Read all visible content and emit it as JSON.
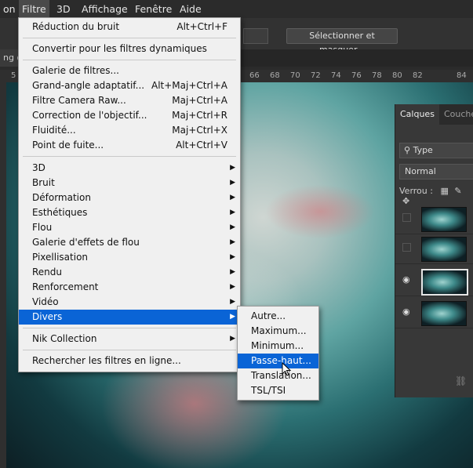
{
  "menubar": {
    "items": [
      "on",
      "Filtre",
      "3D",
      "Affichage",
      "Fenêtre",
      "Aide"
    ]
  },
  "options": {
    "select_mask_button": "Sélectionner et masquer..."
  },
  "doc_tab": "ng @",
  "ruler": {
    "ticks": [
      "5",
      "66",
      "68",
      "70",
      "72",
      "74",
      "76",
      "78",
      "80",
      "82",
      "84"
    ]
  },
  "layers_panel": {
    "tabs": [
      "Calques",
      "Couches"
    ],
    "kind_filter": "Type",
    "blend_mode": "Normal",
    "lock_label": "Verrou :"
  },
  "filter_menu": {
    "items": [
      {
        "label": "Réduction du bruit",
        "shortcut": "Alt+Ctrl+F"
      },
      {
        "label": "Convertir pour les filtres dynamiques",
        "shortcut": ""
      },
      {
        "label": "Galerie de filtres...",
        "shortcut": ""
      },
      {
        "label": "Grand-angle adaptatif...",
        "shortcut": "Alt+Maj+Ctrl+A"
      },
      {
        "label": "Filtre Camera Raw...",
        "shortcut": "Maj+Ctrl+A"
      },
      {
        "label": "Correction de l'objectif...",
        "shortcut": "Maj+Ctrl+R"
      },
      {
        "label": "Fluidité...",
        "shortcut": "Maj+Ctrl+X"
      },
      {
        "label": "Point de fuite...",
        "shortcut": "Alt+Ctrl+V"
      },
      {
        "label": "3D",
        "shortcut": ""
      },
      {
        "label": "Bruit",
        "shortcut": ""
      },
      {
        "label": "Déformation",
        "shortcut": ""
      },
      {
        "label": "Esthétiques",
        "shortcut": ""
      },
      {
        "label": "Flou",
        "shortcut": ""
      },
      {
        "label": "Galerie d'effets de flou",
        "shortcut": ""
      },
      {
        "label": "Pixellisation",
        "shortcut": ""
      },
      {
        "label": "Rendu",
        "shortcut": ""
      },
      {
        "label": "Renforcement",
        "shortcut": ""
      },
      {
        "label": "Vidéo",
        "shortcut": ""
      },
      {
        "label": "Divers",
        "shortcut": ""
      },
      {
        "label": "Nik Collection",
        "shortcut": ""
      },
      {
        "label": "Rechercher les filtres en ligne...",
        "shortcut": ""
      }
    ]
  },
  "divers_submenu": {
    "items": [
      "Autre...",
      "Maximum...",
      "Minimum...",
      "Passe-haut...",
      "Translation...",
      "TSL/TSI"
    ]
  }
}
